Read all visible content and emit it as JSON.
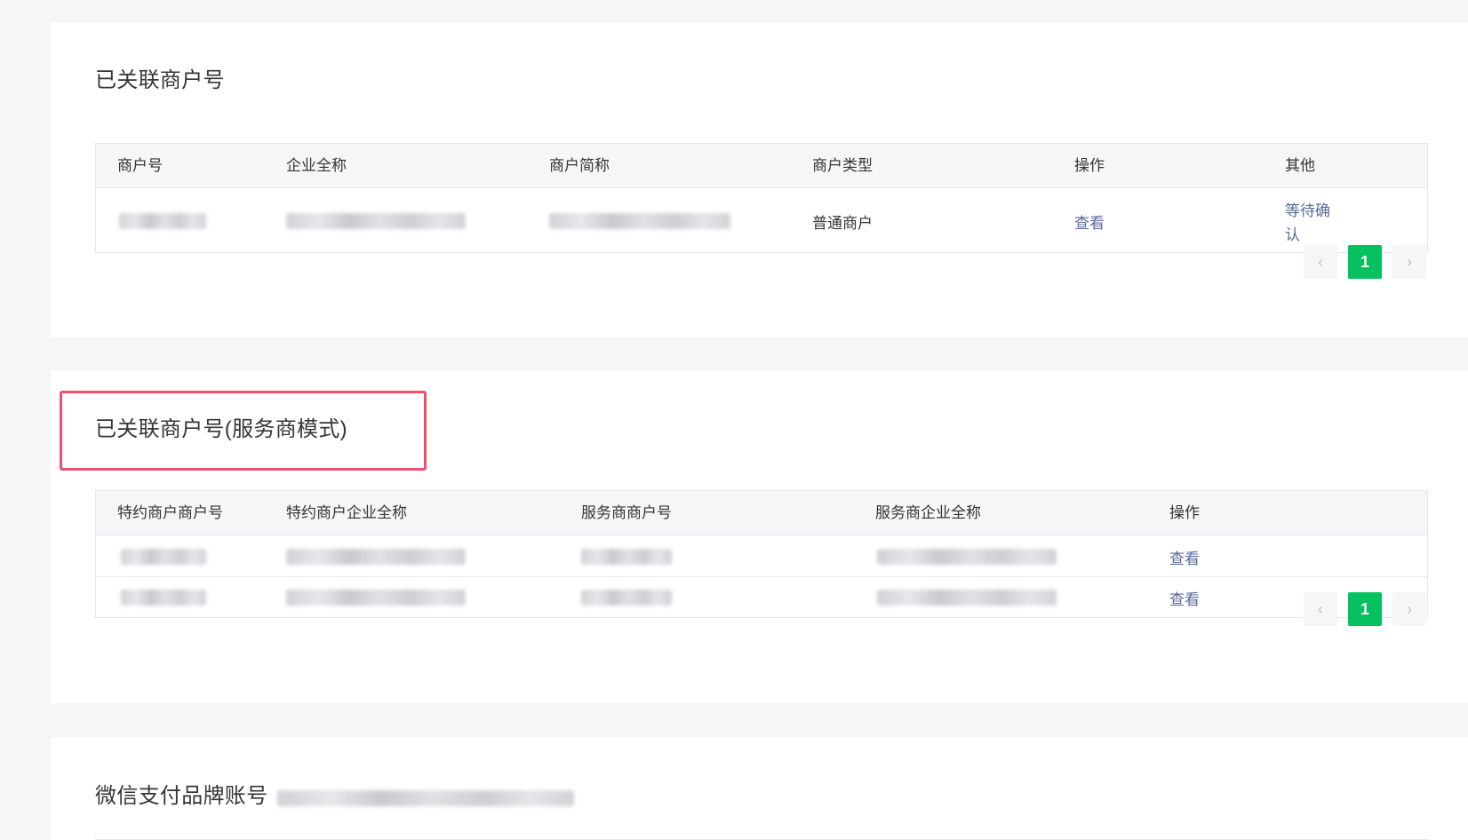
{
  "linked_merchants": {
    "title": "已关联商户号",
    "columns": [
      "商户号",
      "企业全称",
      "商户简称",
      "商户类型",
      "操作",
      "其他"
    ],
    "rows": [
      {
        "merchant_type": "普通商户",
        "action": "查看",
        "other": "等待确认"
      }
    ],
    "pagination": {
      "prev": "‹",
      "current": "1",
      "next": "›"
    }
  },
  "service_provider_mode": {
    "title": "已关联商户号(服务商模式)",
    "columns": [
      "特约商户商户号",
      "特约商户企业全称",
      "服务商商户号",
      "服务商企业全称",
      "操作"
    ],
    "rows": [
      {
        "action": "查看"
      },
      {
        "action": "查看"
      }
    ],
    "pagination": {
      "prev": "‹",
      "current": "1",
      "next": "›"
    }
  },
  "brand_account": {
    "title": "微信支付品牌账号"
  },
  "colors": {
    "accent_green": "#07c160",
    "link_blue": "#576b95",
    "highlight_red": "#f0506e"
  }
}
